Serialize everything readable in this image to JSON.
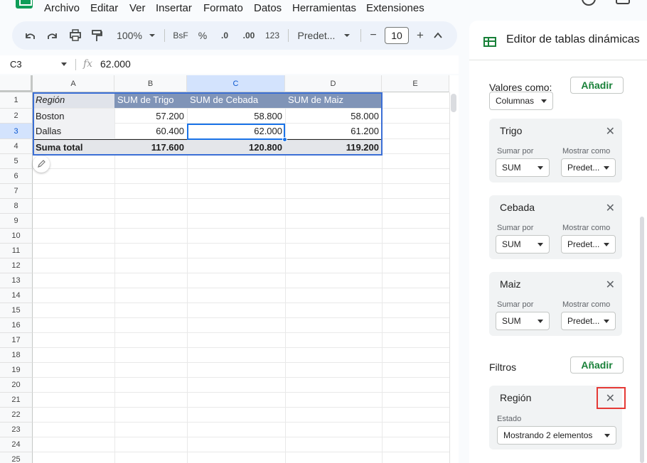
{
  "menu": [
    "Archivo",
    "Editar",
    "Ver",
    "Insertar",
    "Formato",
    "Datos",
    "Herramientas",
    "Extensiones"
  ],
  "toolbar": {
    "undo_icon": "undo-icon",
    "redo_icon": "redo-icon",
    "print_icon": "print-icon",
    "paint_format_icon": "paint-format-icon",
    "zoom": "100%",
    "currency": "BsF",
    "percent": "%",
    "decrease_decimals": ".0",
    "increase_decimals": ".00",
    "number_format": "123",
    "font": "Predet...",
    "font_size": "10",
    "minus": "−",
    "plus": "+",
    "collapse": "^"
  },
  "formula_bar": {
    "cell_ref": "C3",
    "fx": "fx",
    "value": "62.000"
  },
  "columns": [
    "A",
    "B",
    "C",
    "D",
    "E"
  ],
  "rows": [
    "1",
    "2",
    "3",
    "4",
    "5",
    "6",
    "7",
    "8",
    "9",
    "10",
    "11",
    "12",
    "13",
    "14",
    "15",
    "16",
    "17",
    "18",
    "19",
    "20",
    "21",
    "22",
    "23",
    "24",
    "25"
  ],
  "pivot": {
    "headers": [
      "Región",
      "SUM de Trigo",
      "SUM de Cebada",
      "SUM de Maiz"
    ],
    "data": [
      [
        "Boston",
        "57.200",
        "58.800",
        "58.000"
      ],
      [
        "Dallas",
        "60.400",
        "62.000",
        "61.200"
      ]
    ],
    "total": [
      "Suma total",
      "117.600",
      "120.800",
      "119.200"
    ]
  },
  "panel": {
    "title": "Editor de tablas dinámicas",
    "values_as_label": "Valores como:",
    "values_as_value": "Columnas",
    "add_label": "Añadir",
    "value_cards": [
      {
        "name": "Trigo",
        "sum_by_label": "Sumar por",
        "sum_by": "SUM",
        "show_as_label": "Mostrar como",
        "show_as": "Predet..."
      },
      {
        "name": "Cebada",
        "sum_by_label": "Sumar por",
        "sum_by": "SUM",
        "show_as_label": "Mostrar como",
        "show_as": "Predet..."
      },
      {
        "name": "Maiz",
        "sum_by_label": "Sumar por",
        "sum_by": "SUM",
        "show_as_label": "Mostrar como",
        "show_as": "Predet..."
      }
    ],
    "filters_label": "Filtros",
    "filter_card": {
      "name": "Región",
      "status_label": "Estado",
      "status_value": "Mostrando 2 elementos"
    },
    "close_symbol": "✕"
  },
  "colors": {
    "pivot_header": "#8094b7",
    "accent": "#1a73e8",
    "green": "#188038",
    "highlight": "#e53935"
  }
}
